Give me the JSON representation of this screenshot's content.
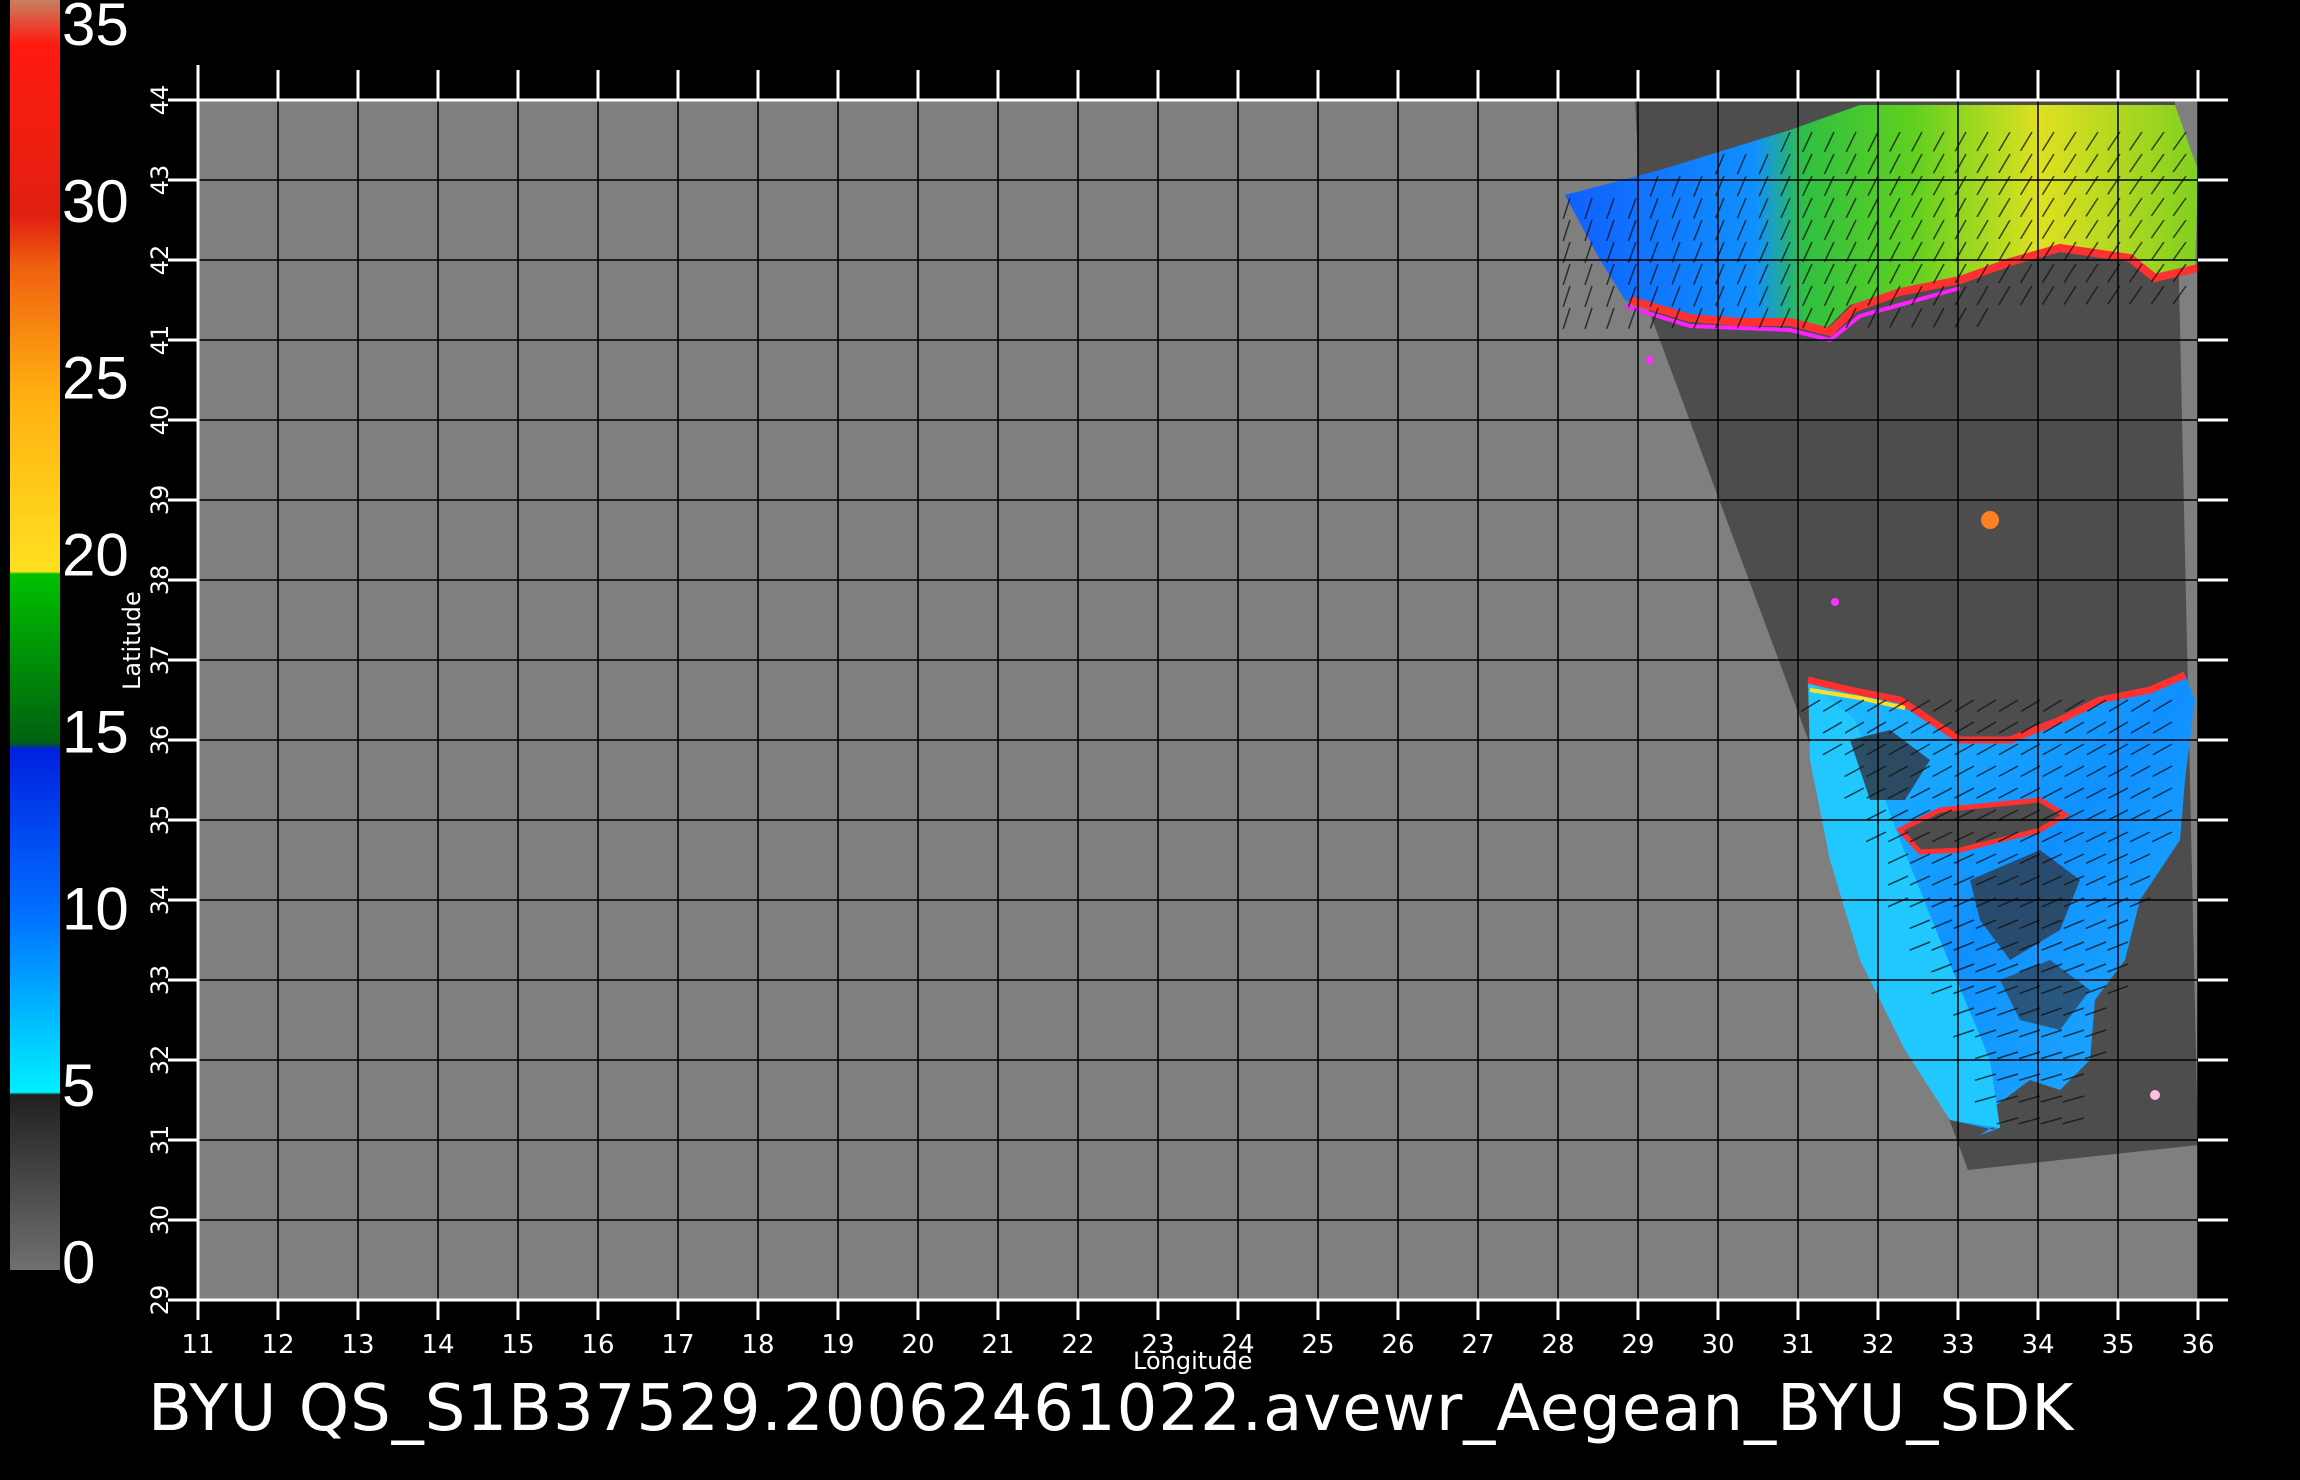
{
  "colorbar": {
    "labels": [
      "35",
      "30",
      "25",
      "20",
      "15",
      "10",
      "5",
      "0"
    ],
    "colors": {
      "brown": "#c88060",
      "red": "#ff1a10",
      "orange": "#f06010",
      "yellow": "#ffe020",
      "green": "#00b000",
      "blue": "#0050ff",
      "cyan": "#00e0ff",
      "gray": "#505050"
    }
  },
  "axes": {
    "x_ticks": [
      "11",
      "12",
      "13",
      "14",
      "15",
      "16",
      "17",
      "18",
      "19",
      "20",
      "21",
      "22",
      "23",
      "24",
      "25",
      "26",
      "27",
      "28",
      "29",
      "30",
      "31",
      "32",
      "33",
      "34",
      "35",
      "36"
    ],
    "y_ticks": [
      "29",
      "30",
      "31",
      "32",
      "33",
      "34",
      "35",
      "36",
      "37",
      "38",
      "39",
      "40",
      "41",
      "42",
      "43",
      "44"
    ],
    "x_title": "Longitude",
    "y_title": "Latitude"
  },
  "title": "BYU  QS_S1B37529.20062461022.avewr_Aegean_BYU_SDK",
  "colors": {
    "background": "#000000",
    "map_fill": "#7f7f7f",
    "swath_dark": "#4d4d4d",
    "grid": "#000000"
  }
}
